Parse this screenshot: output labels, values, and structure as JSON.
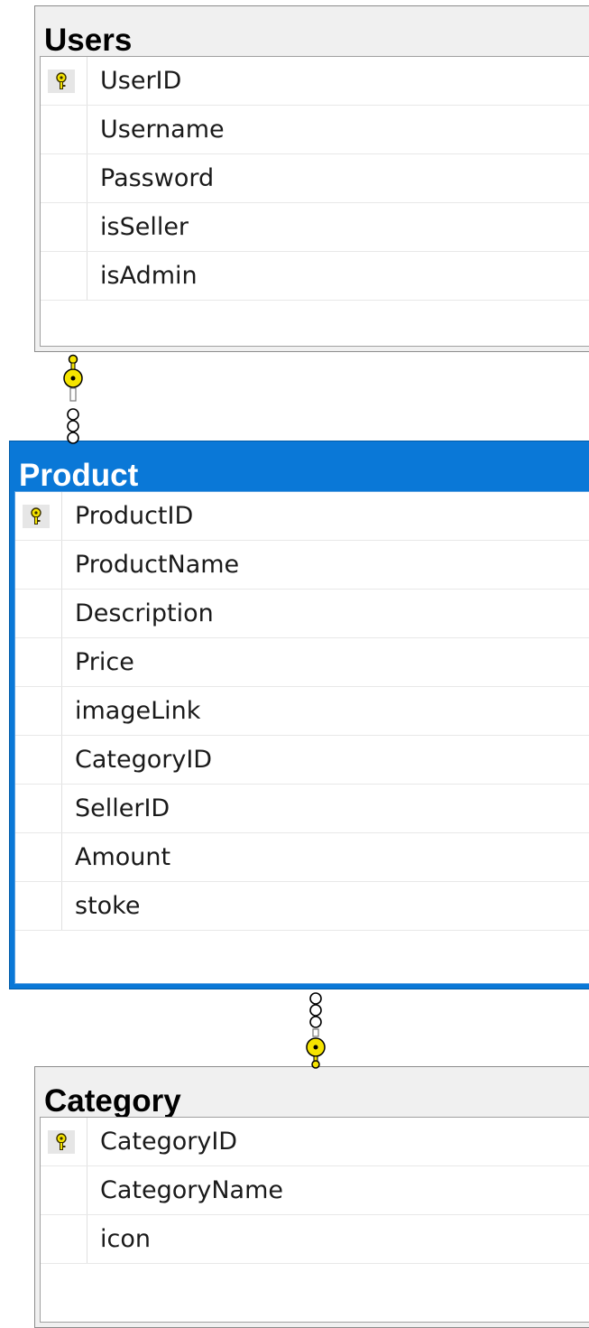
{
  "tables": {
    "users": {
      "title": "Users",
      "columns": [
        {
          "name": "UserID",
          "pk": true
        },
        {
          "name": "Username",
          "pk": false
        },
        {
          "name": "Password",
          "pk": false
        },
        {
          "name": "isSeller",
          "pk": false
        },
        {
          "name": "isAdmin",
          "pk": false
        }
      ]
    },
    "product": {
      "title": "Product",
      "selected": true,
      "columns": [
        {
          "name": "ProductID",
          "pk": true
        },
        {
          "name": "ProductName",
          "pk": false
        },
        {
          "name": "Description",
          "pk": false
        },
        {
          "name": "Price",
          "pk": false
        },
        {
          "name": "imageLink",
          "pk": false
        },
        {
          "name": "CategoryID",
          "pk": false
        },
        {
          "name": "SellerID",
          "pk": false
        },
        {
          "name": "Amount",
          "pk": false
        },
        {
          "name": "stoke",
          "pk": false
        }
      ]
    },
    "category": {
      "title": "Category",
      "columns": [
        {
          "name": "CategoryID",
          "pk": true
        },
        {
          "name": "CategoryName",
          "pk": false
        },
        {
          "name": "icon",
          "pk": false
        }
      ]
    }
  },
  "relationships": [
    {
      "from": "users",
      "to": "product",
      "one_end": "key-icon",
      "many_end": "infinity-icon"
    },
    {
      "from": "category",
      "to": "product",
      "one_end": "key-icon",
      "many_end": "infinity-icon"
    }
  ],
  "colors": {
    "selected_header": "#0a78d7",
    "header": "#f0f0f0",
    "key": "#f5e400"
  }
}
